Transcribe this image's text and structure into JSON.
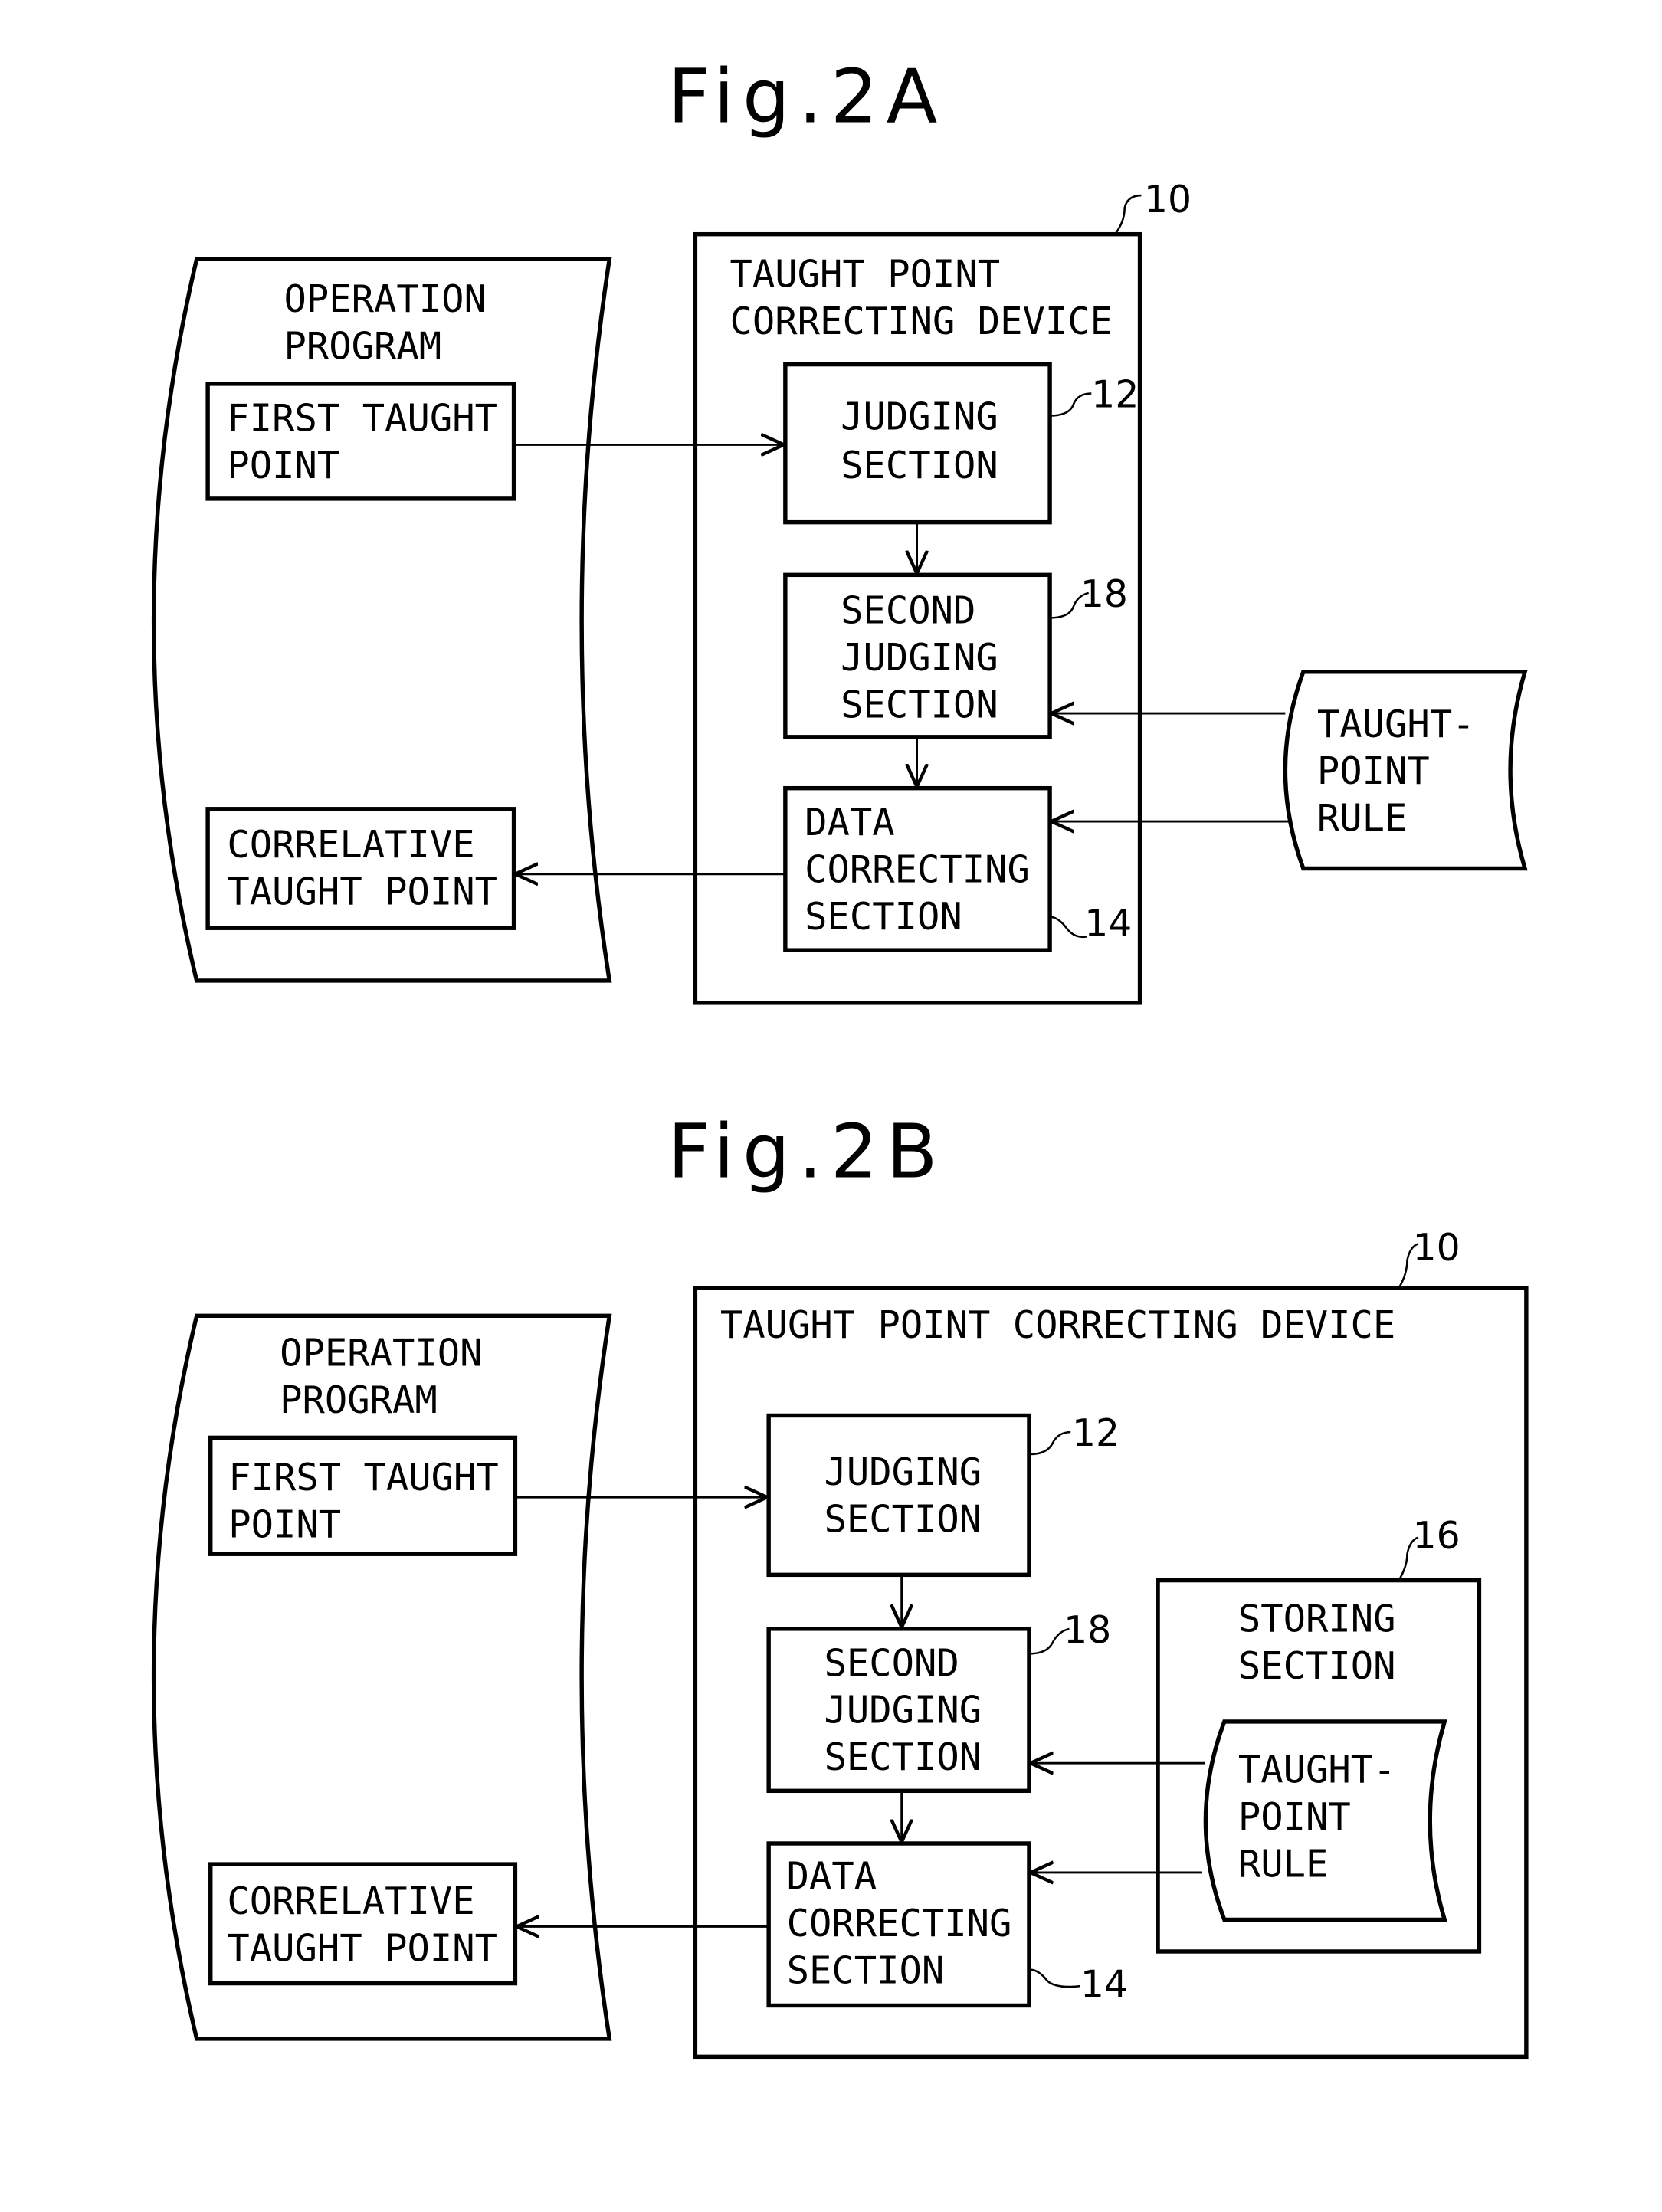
{
  "figures": [
    {
      "id": "fig2a",
      "title": "Fig.2A",
      "device": {
        "label_lines": [
          "TAUGHT POINT",
          "CORRECTING DEVICE"
        ],
        "ref": "10"
      },
      "program": {
        "label_lines": [
          "OPERATION",
          "PROGRAM"
        ],
        "first_point": [
          "FIRST TAUGHT",
          "POINT"
        ],
        "correlative_point": [
          "CORRELATIVE",
          "TAUGHT POINT"
        ]
      },
      "judging": {
        "label_lines": [
          "JUDGING",
          "SECTION"
        ],
        "ref": "12"
      },
      "second_judging": {
        "label_lines": [
          "SECOND",
          "JUDGING",
          "SECTION"
        ],
        "ref": "18"
      },
      "data_correcting": {
        "label_lines": [
          "DATA",
          "CORRECTING",
          "SECTION"
        ],
        "ref": "14"
      },
      "rule": {
        "label_lines": [
          "TAUGHT-",
          "POINT",
          "RULE"
        ]
      }
    },
    {
      "id": "fig2b",
      "title": "Fig.2B",
      "device": {
        "label_lines": [
          "TAUGHT POINT CORRECTING DEVICE"
        ],
        "ref": "10"
      },
      "program": {
        "label_lines": [
          "OPERATION",
          "PROGRAM"
        ],
        "first_point": [
          "FIRST TAUGHT",
          "POINT"
        ],
        "correlative_point": [
          "CORRELATIVE",
          "TAUGHT POINT"
        ]
      },
      "judging": {
        "label_lines": [
          "JUDGING",
          "SECTION"
        ],
        "ref": "12"
      },
      "second_judging": {
        "label_lines": [
          "SECOND",
          "JUDGING",
          "SECTION"
        ],
        "ref": "18"
      },
      "data_correcting": {
        "label_lines": [
          "DATA",
          "CORRECTING",
          "SECTION"
        ],
        "ref": "14"
      },
      "storing": {
        "label_lines": [
          "STORING",
          "SECTION"
        ],
        "ref": "16"
      },
      "rule": {
        "label_lines": [
          "TAUGHT-",
          "POINT",
          "RULE"
        ]
      }
    }
  ]
}
